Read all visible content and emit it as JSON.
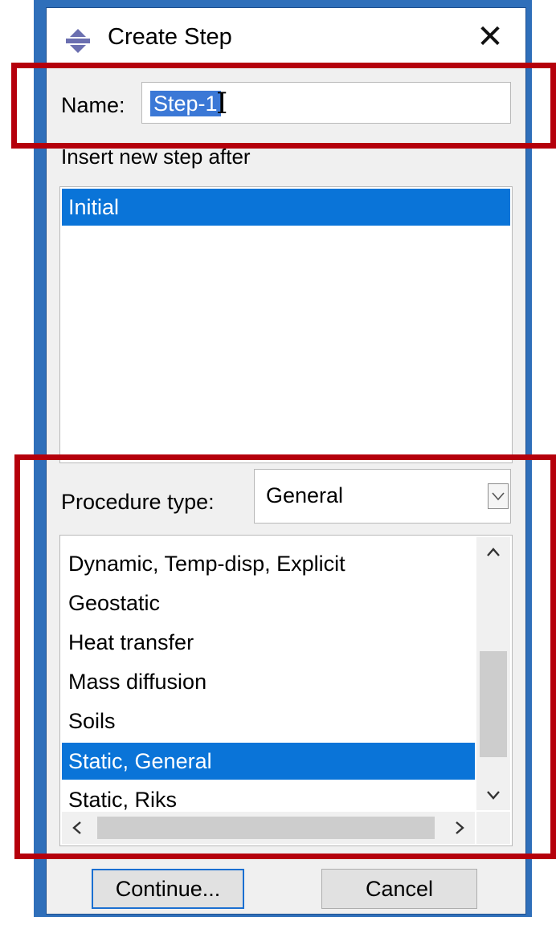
{
  "dialog": {
    "title": "Create Step",
    "close_glyph": "✕",
    "title_icon": "abaqus-step-icon"
  },
  "name": {
    "label": "Name:",
    "value": "Step-1"
  },
  "insert_after": {
    "label": "Insert new step after",
    "items": [
      "Initial"
    ],
    "selected": "Initial"
  },
  "procedure": {
    "label": "Procedure type:",
    "value": "General",
    "items": [
      "Dynamic, Temp-disp, Explicit",
      "Geostatic",
      "Heat transfer",
      "Mass diffusion",
      "Soils",
      "Static, General",
      "Static, Riks"
    ],
    "selected": "Static, General"
  },
  "buttons": {
    "continue": "Continue...",
    "cancel": "Cancel"
  },
  "colors": {
    "selection": "#0a74d8",
    "highlight_box": "#b5000c",
    "backdrop": "#2f6fba"
  }
}
